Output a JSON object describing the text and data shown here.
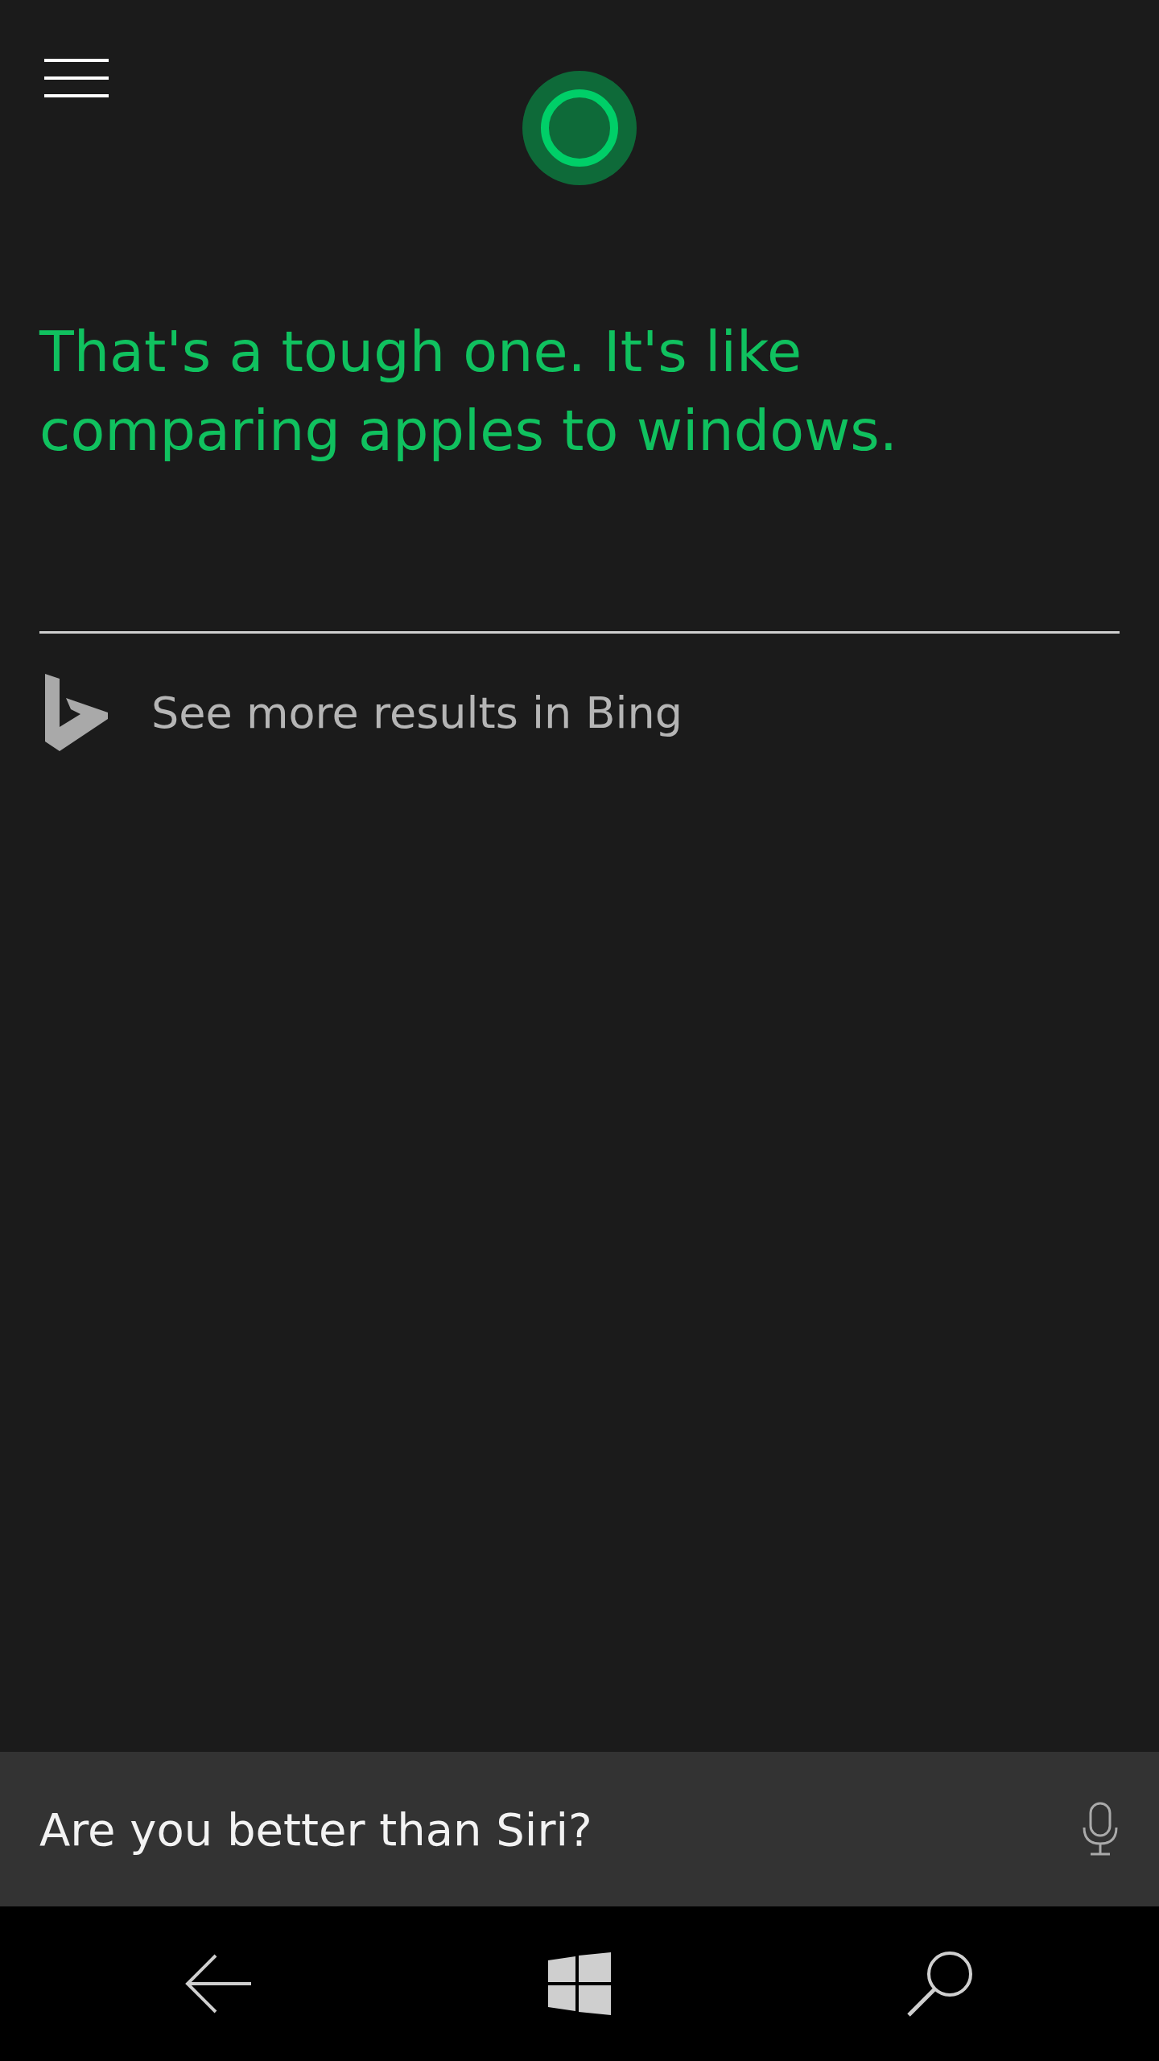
{
  "response": {
    "text": "That's a tough one. It's like comparing apples to windows."
  },
  "web_link": {
    "label": "See more results in Bing"
  },
  "query_bar": {
    "value": "Are you better than Siri?"
  }
}
